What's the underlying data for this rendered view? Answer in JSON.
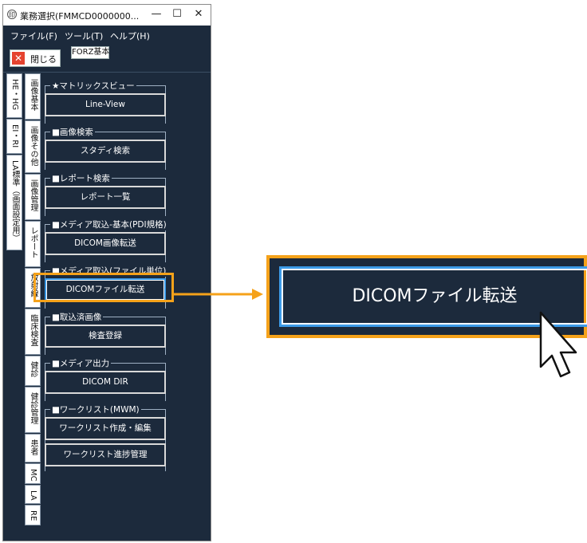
{
  "window": {
    "title": "業務選択(FMMCD0000000...",
    "min_glyph": "—",
    "max_glyph": "☐",
    "close_glyph": "✕"
  },
  "menu": {
    "file": "ファイル(F)",
    "tool": "ツール(T)",
    "help": "ヘルプ(H)"
  },
  "toolbar": {
    "close_label": "閉じる",
    "close_glyph": "✕",
    "tab_label": "FORZ基本"
  },
  "outer_tabs": [
    {
      "label": "HE・HG"
    },
    {
      "label": "EI・RI"
    },
    {
      "label": "LA標準（画面設定用）"
    }
  ],
  "inner_tabs": [
    {
      "label": "画像基本"
    },
    {
      "label": "画像その他"
    },
    {
      "label": "画像管理"
    },
    {
      "label": "レポート"
    },
    {
      "label": "放射線"
    },
    {
      "label": "臨床検査"
    },
    {
      "label": "健診"
    },
    {
      "label": "健診管理"
    },
    {
      "label": "患者"
    },
    {
      "label": "MC"
    },
    {
      "label": "LA"
    },
    {
      "label": "RE"
    }
  ],
  "groups": [
    {
      "title": "★マトリックスビュー",
      "button": "Line-View"
    },
    {
      "title": "■画像検索",
      "button": "スタディ検索"
    },
    {
      "title": "■レポート検索",
      "button": "レポート一覧"
    },
    {
      "title": "■メディア取込-基本(PDI規格)",
      "button": "DICOM画像転送"
    },
    {
      "title": "■メディア取込(ファイル単位)",
      "button": "DICOMファイル転送"
    },
    {
      "title": "■取込済画像",
      "button": "検査登録"
    },
    {
      "title": "■メディア出力",
      "button": "DICOM DIR"
    },
    {
      "title": "■ワークリスト(MWM)",
      "button": "ワークリスト作成・編集"
    },
    {
      "title": "",
      "button": "ワークリスト進捗管理"
    }
  ],
  "callout": {
    "zoom_label": "DICOMファイル転送"
  },
  "colors": {
    "panel": "#1c2a3c",
    "highlight": "#f5a21a",
    "selected_border": "#3c9be8"
  }
}
